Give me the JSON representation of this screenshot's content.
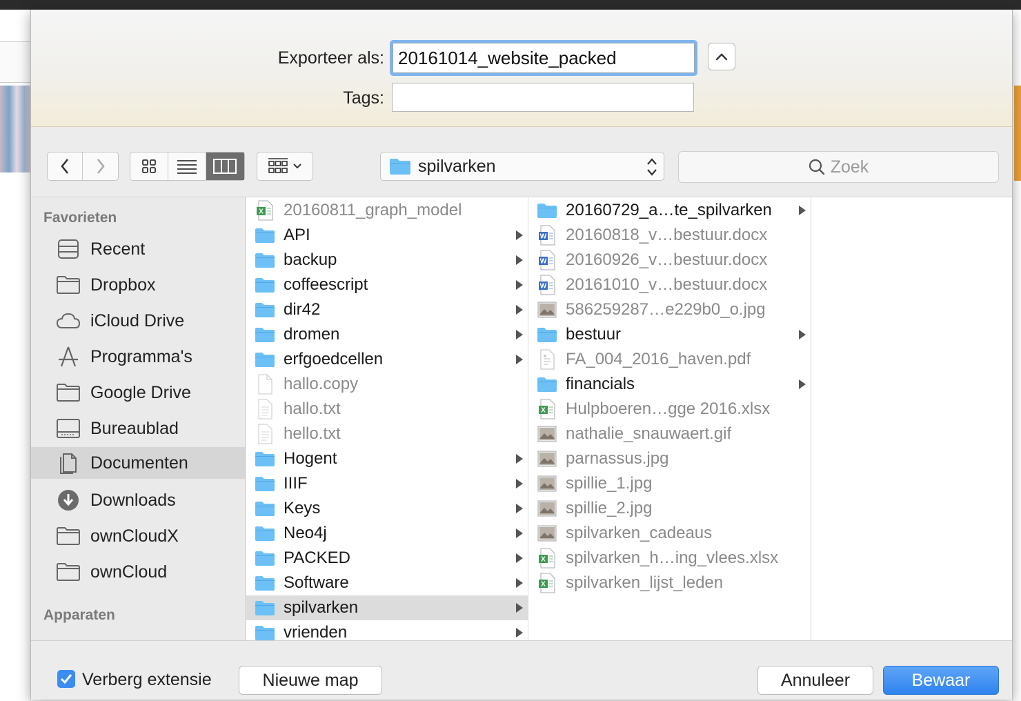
{
  "export": {
    "label": "Exporteer als:",
    "value": "20161014_website_packed",
    "tags_label": "Tags:",
    "tags_value": ""
  },
  "toolbar": {
    "location": "spilvarken",
    "search_placeholder": "Zoek"
  },
  "sidebar": {
    "favorites_header": "Favorieten",
    "devices_header": "Apparaten",
    "items": [
      {
        "label": "Recent",
        "icon": "recent-icon"
      },
      {
        "label": "Dropbox",
        "icon": "folder-icon"
      },
      {
        "label": "iCloud Drive",
        "icon": "cloud-icon"
      },
      {
        "label": "Programma's",
        "icon": "applications-icon"
      },
      {
        "label": "Google Drive",
        "icon": "folder-icon"
      },
      {
        "label": "Bureaublad",
        "icon": "desktop-icon"
      },
      {
        "label": "Documenten",
        "icon": "documents-icon"
      },
      {
        "label": "Downloads",
        "icon": "downloads-icon"
      },
      {
        "label": "ownCloudX",
        "icon": "folder-icon"
      },
      {
        "label": "ownCloud",
        "icon": "folder-icon"
      }
    ],
    "selected": "Documenten"
  },
  "column1": [
    {
      "name": "20160811_graph_model",
      "type": "xlsx"
    },
    {
      "name": "API",
      "type": "folder"
    },
    {
      "name": "backup",
      "type": "folder"
    },
    {
      "name": "coffeescript",
      "type": "folder"
    },
    {
      "name": "dir42",
      "type": "folder"
    },
    {
      "name": "dromen",
      "type": "folder"
    },
    {
      "name": "erfgoedcellen",
      "type": "folder"
    },
    {
      "name": "hallo.copy",
      "type": "blank"
    },
    {
      "name": "hallo.txt",
      "type": "text"
    },
    {
      "name": "hello.txt",
      "type": "text"
    },
    {
      "name": "Hogent",
      "type": "folder"
    },
    {
      "name": "IIIF",
      "type": "folder"
    },
    {
      "name": "Keys",
      "type": "folder"
    },
    {
      "name": "Neo4j",
      "type": "folder"
    },
    {
      "name": "PACKED",
      "type": "folder"
    },
    {
      "name": "Software",
      "type": "folder"
    },
    {
      "name": "spilvarken",
      "type": "folder",
      "selected": true
    },
    {
      "name": "vrienden",
      "type": "folder"
    }
  ],
  "column2": [
    {
      "name": "20160729_a…te_spilvarken",
      "type": "folder"
    },
    {
      "name": "20160818_v…bestuur.docx",
      "type": "docx"
    },
    {
      "name": "20160926_v…bestuur.docx",
      "type": "docx"
    },
    {
      "name": "20161010_v…bestuur.docx",
      "type": "docx"
    },
    {
      "name": "586259287…e229b0_o.jpg",
      "type": "image"
    },
    {
      "name": "bestuur",
      "type": "folder"
    },
    {
      "name": "FA_004_2016_haven.pdf",
      "type": "pdf"
    },
    {
      "name": "financials",
      "type": "folder"
    },
    {
      "name": "Hulpboeren…gge 2016.xlsx",
      "type": "xlsx"
    },
    {
      "name": "nathalie_snauwaert.gif",
      "type": "image"
    },
    {
      "name": "parnassus.jpg",
      "type": "image"
    },
    {
      "name": "spillie_1.jpg",
      "type": "image"
    },
    {
      "name": "spillie_2.jpg",
      "type": "image"
    },
    {
      "name": "spilvarken_cadeaus",
      "type": "image"
    },
    {
      "name": "spilvarken_h…ing_vlees.xlsx",
      "type": "xlsx"
    },
    {
      "name": "spilvarken_lijst_leden",
      "type": "xlsx"
    }
  ],
  "bottom": {
    "hide_extension_label": "Verberg extensie",
    "hide_extension_checked": true,
    "new_folder_label": "Nieuwe map",
    "cancel_label": "Annuleer",
    "save_label": "Bewaar"
  },
  "colors": {
    "accent": "#3b8df0",
    "folder": "#6cc0f5",
    "selection": "#dcdcdc"
  }
}
